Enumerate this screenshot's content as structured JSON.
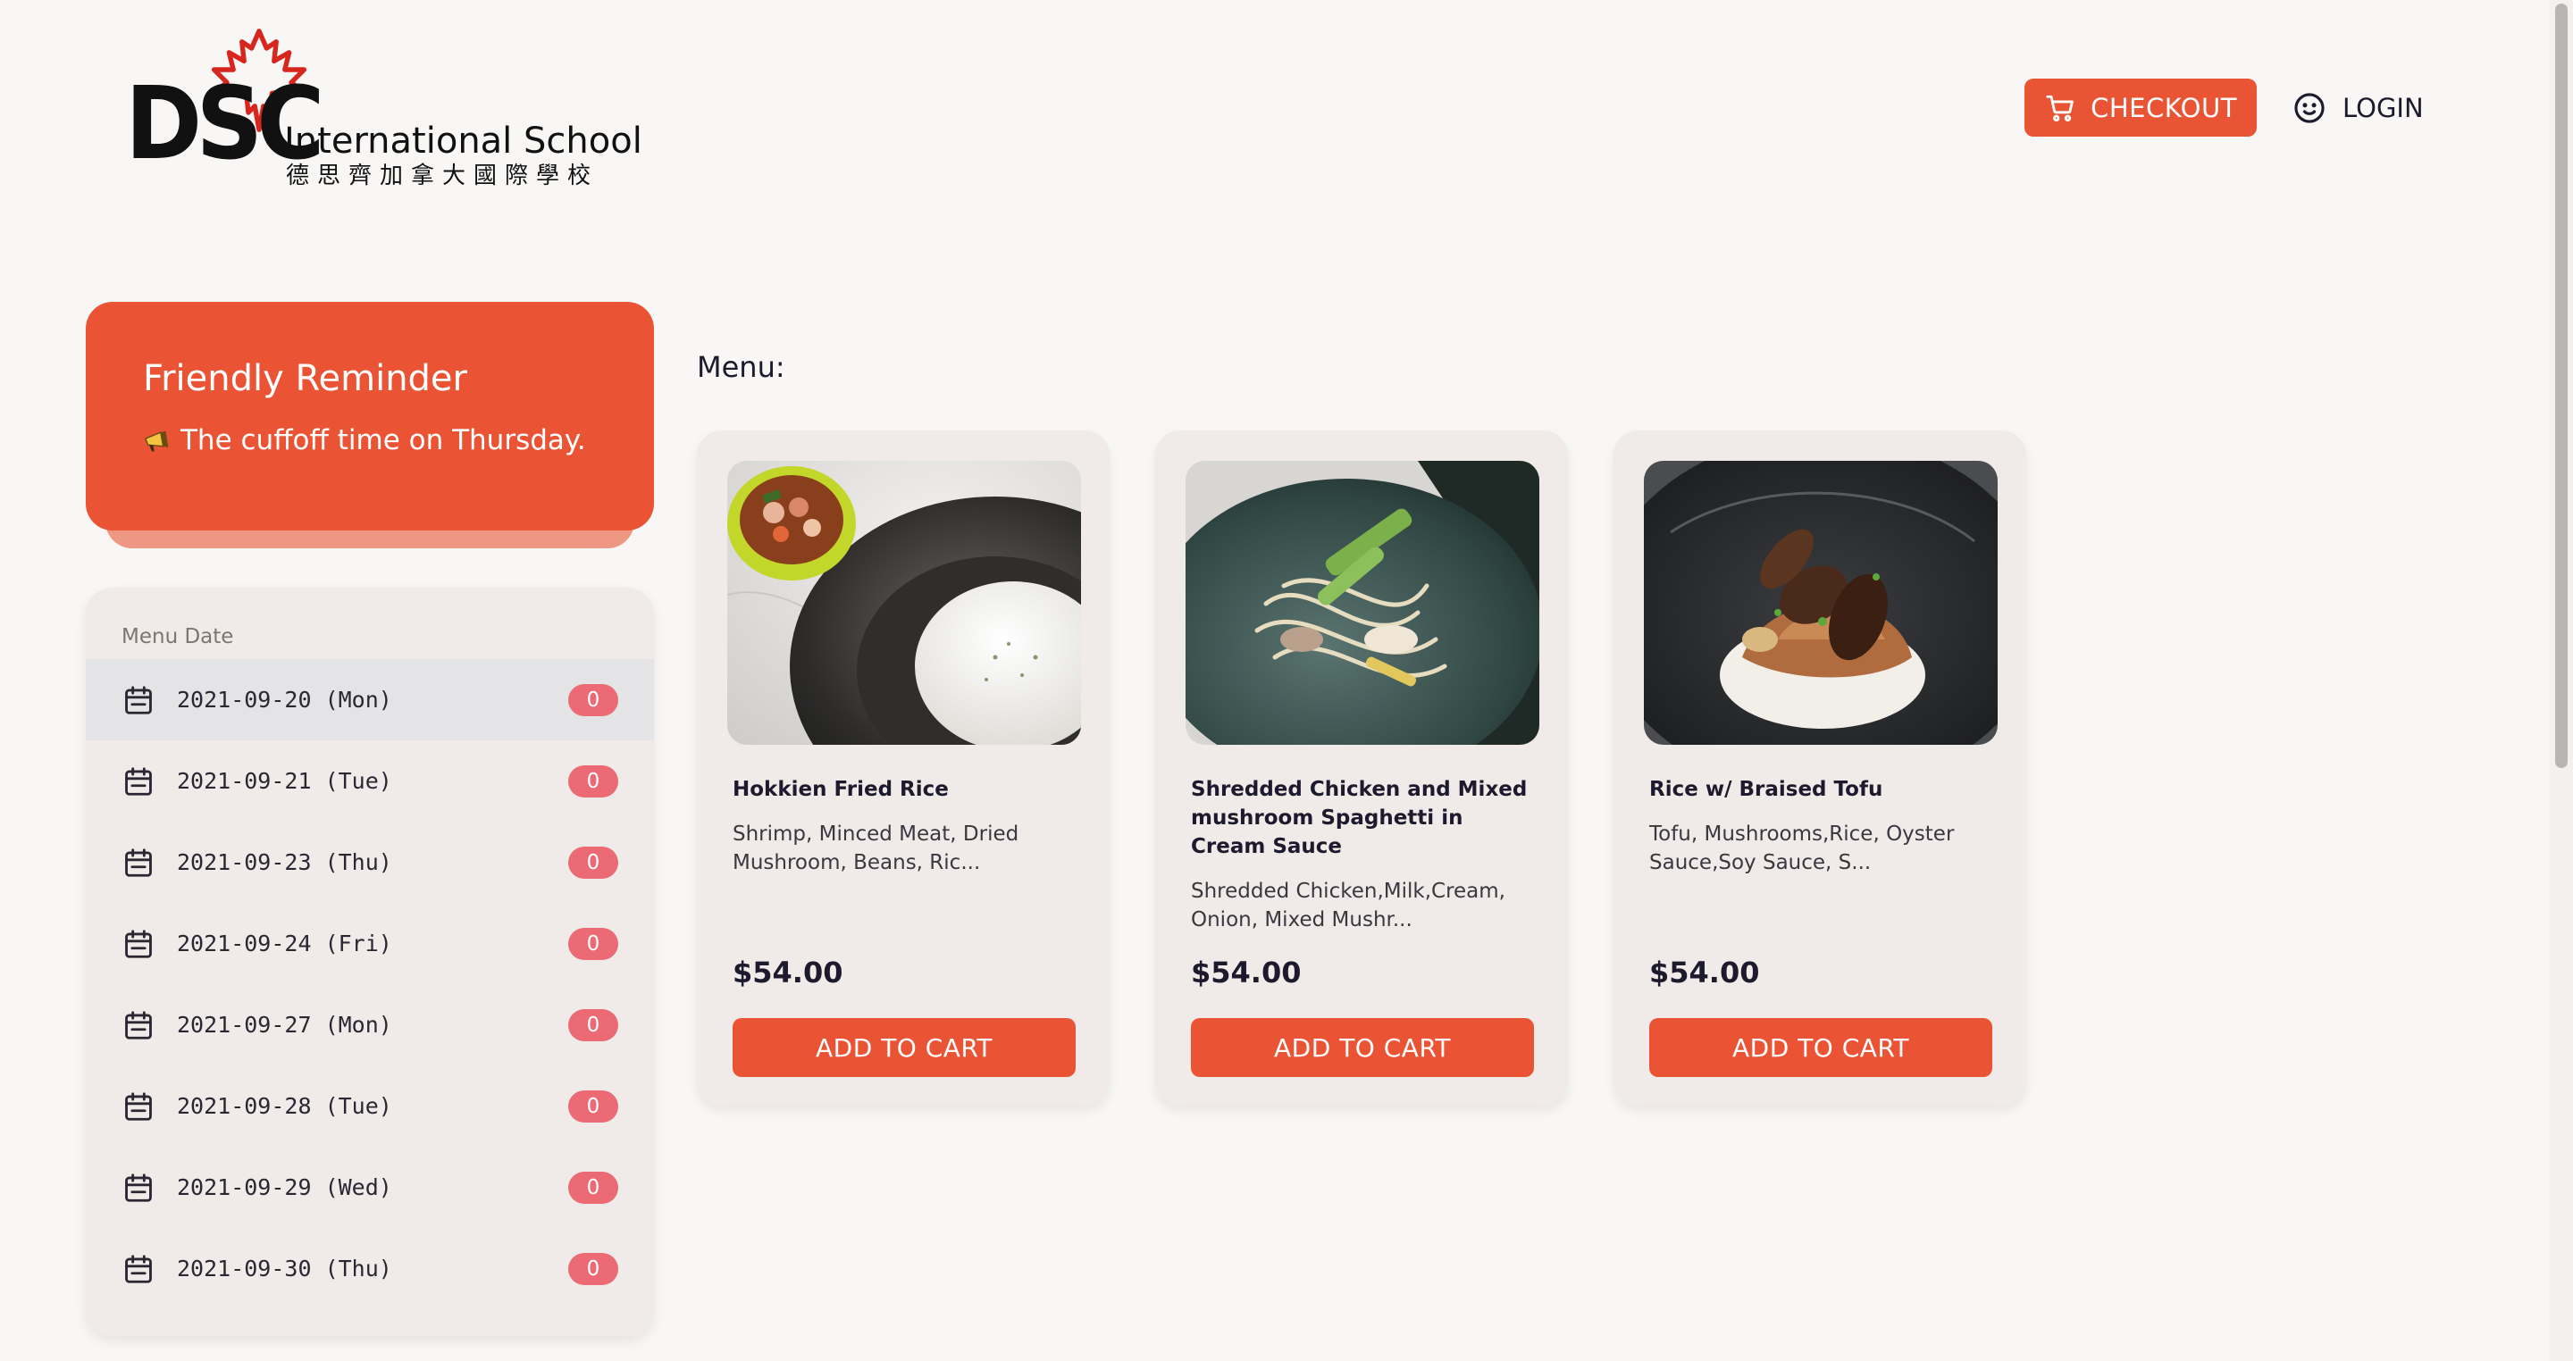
{
  "header": {
    "logo": {
      "abbr": "DSC",
      "name_en": "International School",
      "name_zh": "德思齊加拿大國際學校"
    },
    "checkout_label": "CHECKOUT",
    "login_label": "LOGIN"
  },
  "reminder": {
    "title": "Friendly Reminder",
    "text": "The cuffoff time on Thursday."
  },
  "date_panel": {
    "title": "Menu Date",
    "items": [
      {
        "date": "2021-09-20 (Mon)",
        "count": "0",
        "active": true
      },
      {
        "date": "2021-09-21 (Tue)",
        "count": "0"
      },
      {
        "date": "2021-09-23 (Thu)",
        "count": "0"
      },
      {
        "date": "2021-09-24 (Fri)",
        "count": "0"
      },
      {
        "date": "2021-09-27 (Mon)",
        "count": "0"
      },
      {
        "date": "2021-09-28 (Tue)",
        "count": "0"
      },
      {
        "date": "2021-09-29 (Wed)",
        "count": "0"
      },
      {
        "date": "2021-09-30 (Thu)",
        "count": "0"
      }
    ]
  },
  "menu": {
    "label": "Menu:",
    "items": [
      {
        "name": "Hokkien Fried Rice",
        "description": "Shrimp, Minced Meat, Dried Mushroom, Beans, Ric...",
        "price": "$54.00",
        "button_label": "ADD TO CART"
      },
      {
        "name": "Shredded Chicken and Mixed mushroom Spaghetti in Cream Sauce",
        "description": "Shredded Chicken,Milk,Cream, Onion, Mixed Mushr...",
        "price": "$54.00",
        "button_label": "ADD TO CART"
      },
      {
        "name": "Rice w/ Braised Tofu",
        "description": "Tofu, Mushrooms,Rice, Oyster Sauce,Soy Sauce, S...",
        "price": "$54.00",
        "button_label": "ADD TO CART"
      }
    ]
  },
  "colors": {
    "accent": "#ea5435",
    "badge": "#ec6a74",
    "background": "#f9f7f5",
    "card": "#f0ebe8"
  },
  "icons": {
    "checkout": "cart-icon",
    "login": "smiley-icon",
    "date": "calendar-icon",
    "reminder": "megaphone-icon",
    "logo": "maple-leaf-icon"
  }
}
